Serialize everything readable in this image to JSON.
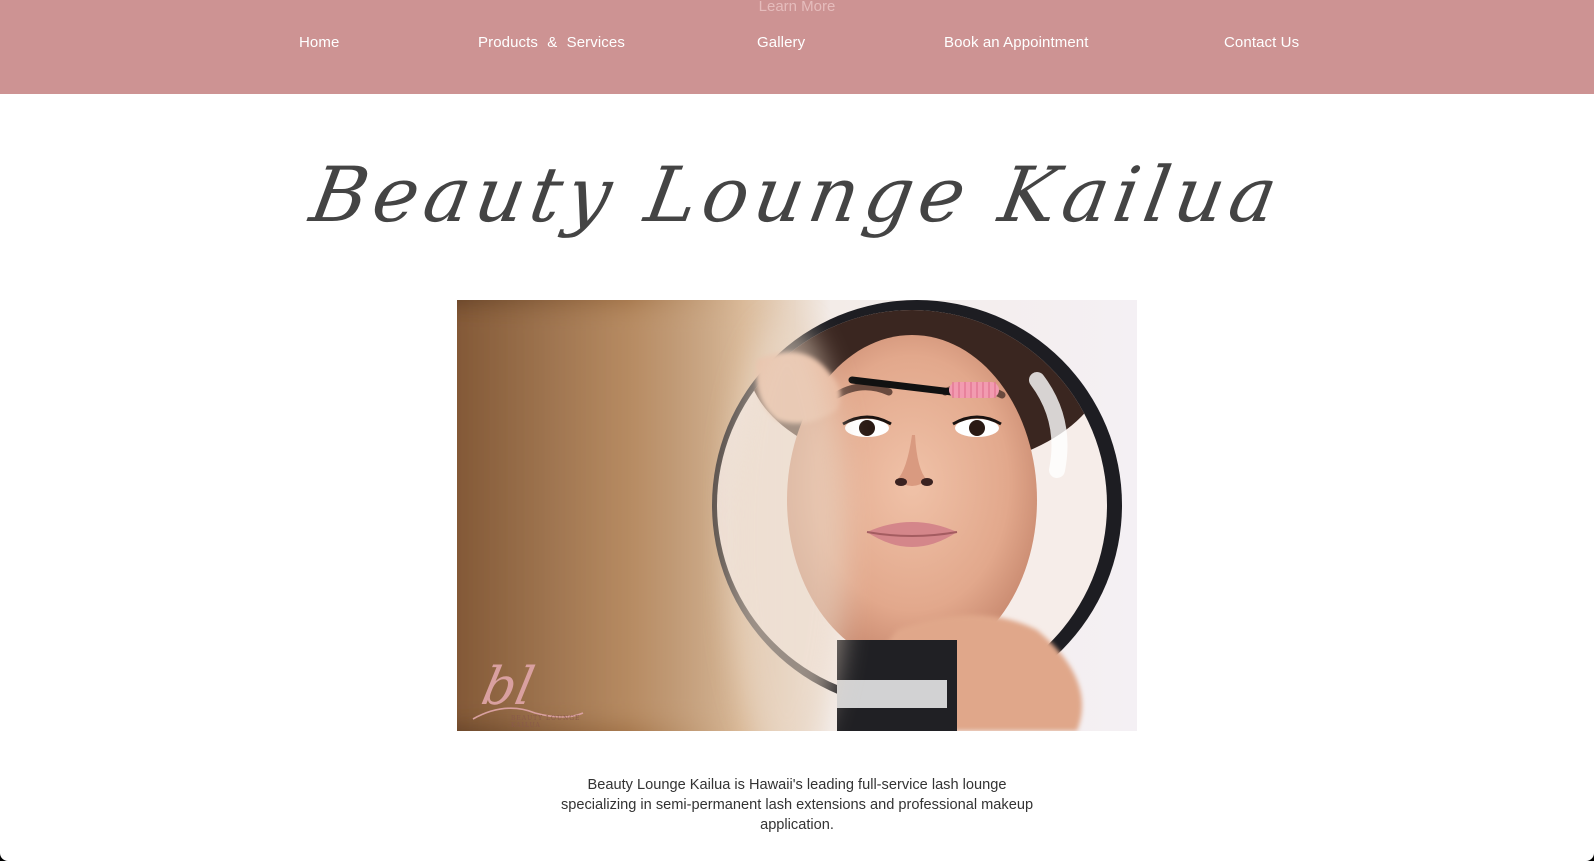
{
  "header": {
    "learn_more": "Learn More",
    "nav": {
      "home": "Home",
      "products_services": "Products & Services",
      "gallery": "Gallery",
      "book": "Book an Appointment",
      "contact": "Contact Us"
    }
  },
  "main": {
    "title": "Beauty Lounge Kailua",
    "hero_logo": {
      "letters": "bl",
      "subtext": "BEAUTY LOUNGE KAILUA"
    },
    "description": "Beauty Lounge Kailua is Hawaii's leading full-service lash lounge specializing in semi-permanent lash extensions and professional makeup application."
  },
  "colors": {
    "nav_background": "#cd9393",
    "nav_text": "#ffffff",
    "title_text": "#444444",
    "body_text": "#333333"
  }
}
